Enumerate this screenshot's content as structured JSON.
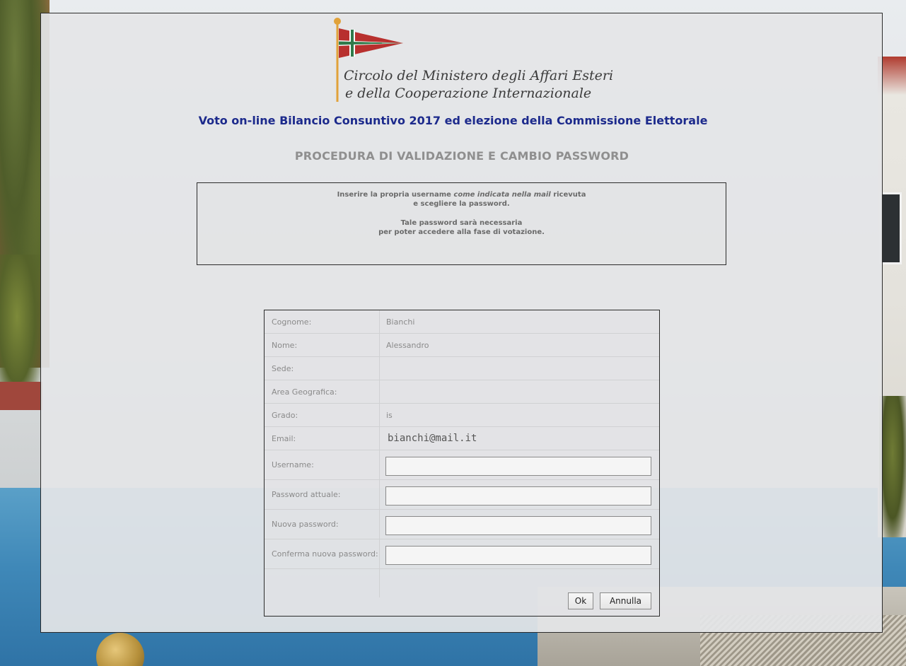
{
  "logo": {
    "line1": "Circolo del Ministero degli Affari Esteri",
    "line2": "e della Cooperazione Internazionale",
    "flag_colors": {
      "red": "#b8302e",
      "green": "#2f7a4a",
      "white": "#ffffff",
      "pole": "#e1a23a"
    }
  },
  "page": {
    "title": "Voto on-line Bilancio Consuntivo 2017 ed elezione della Commissione Elettorale",
    "subtitle": "PROCEDURA DI VALIDAZIONE E CAMBIO PASSWORD"
  },
  "info": {
    "line1_pre": "Inserire la propria username ",
    "line1_em": "come indicata nella mail",
    "line1_post": " ricevuta",
    "line2": "e scegliere la password.",
    "line3": "Tale password sarà necessaria",
    "line4": "per poter accedere alla fase di votazione."
  },
  "form": {
    "cognome_label": "Cognome:",
    "cognome_value": "Bianchi",
    "nome_label": "Nome:",
    "nome_value": "Alessandro",
    "sede_label": "Sede:",
    "sede_value": "",
    "area_label": "Area Geografica:",
    "area_value": "",
    "grado_label": "Grado:",
    "grado_value": "is",
    "email_label": "Email:",
    "email_value": "bianchi@mail.it",
    "username_label": "Username:",
    "username_value": "",
    "password_label": "Password attuale:",
    "password_value": "",
    "new_password_label": "Nuova password:",
    "new_password_value": "",
    "confirm_password_label": "Conferma nuova password:",
    "confirm_password_value": ""
  },
  "buttons": {
    "ok": "Ok",
    "cancel": "Annulla"
  },
  "colors": {
    "title_blue": "#1c2a8c",
    "subtitle_gray": "#8f8f8f"
  }
}
